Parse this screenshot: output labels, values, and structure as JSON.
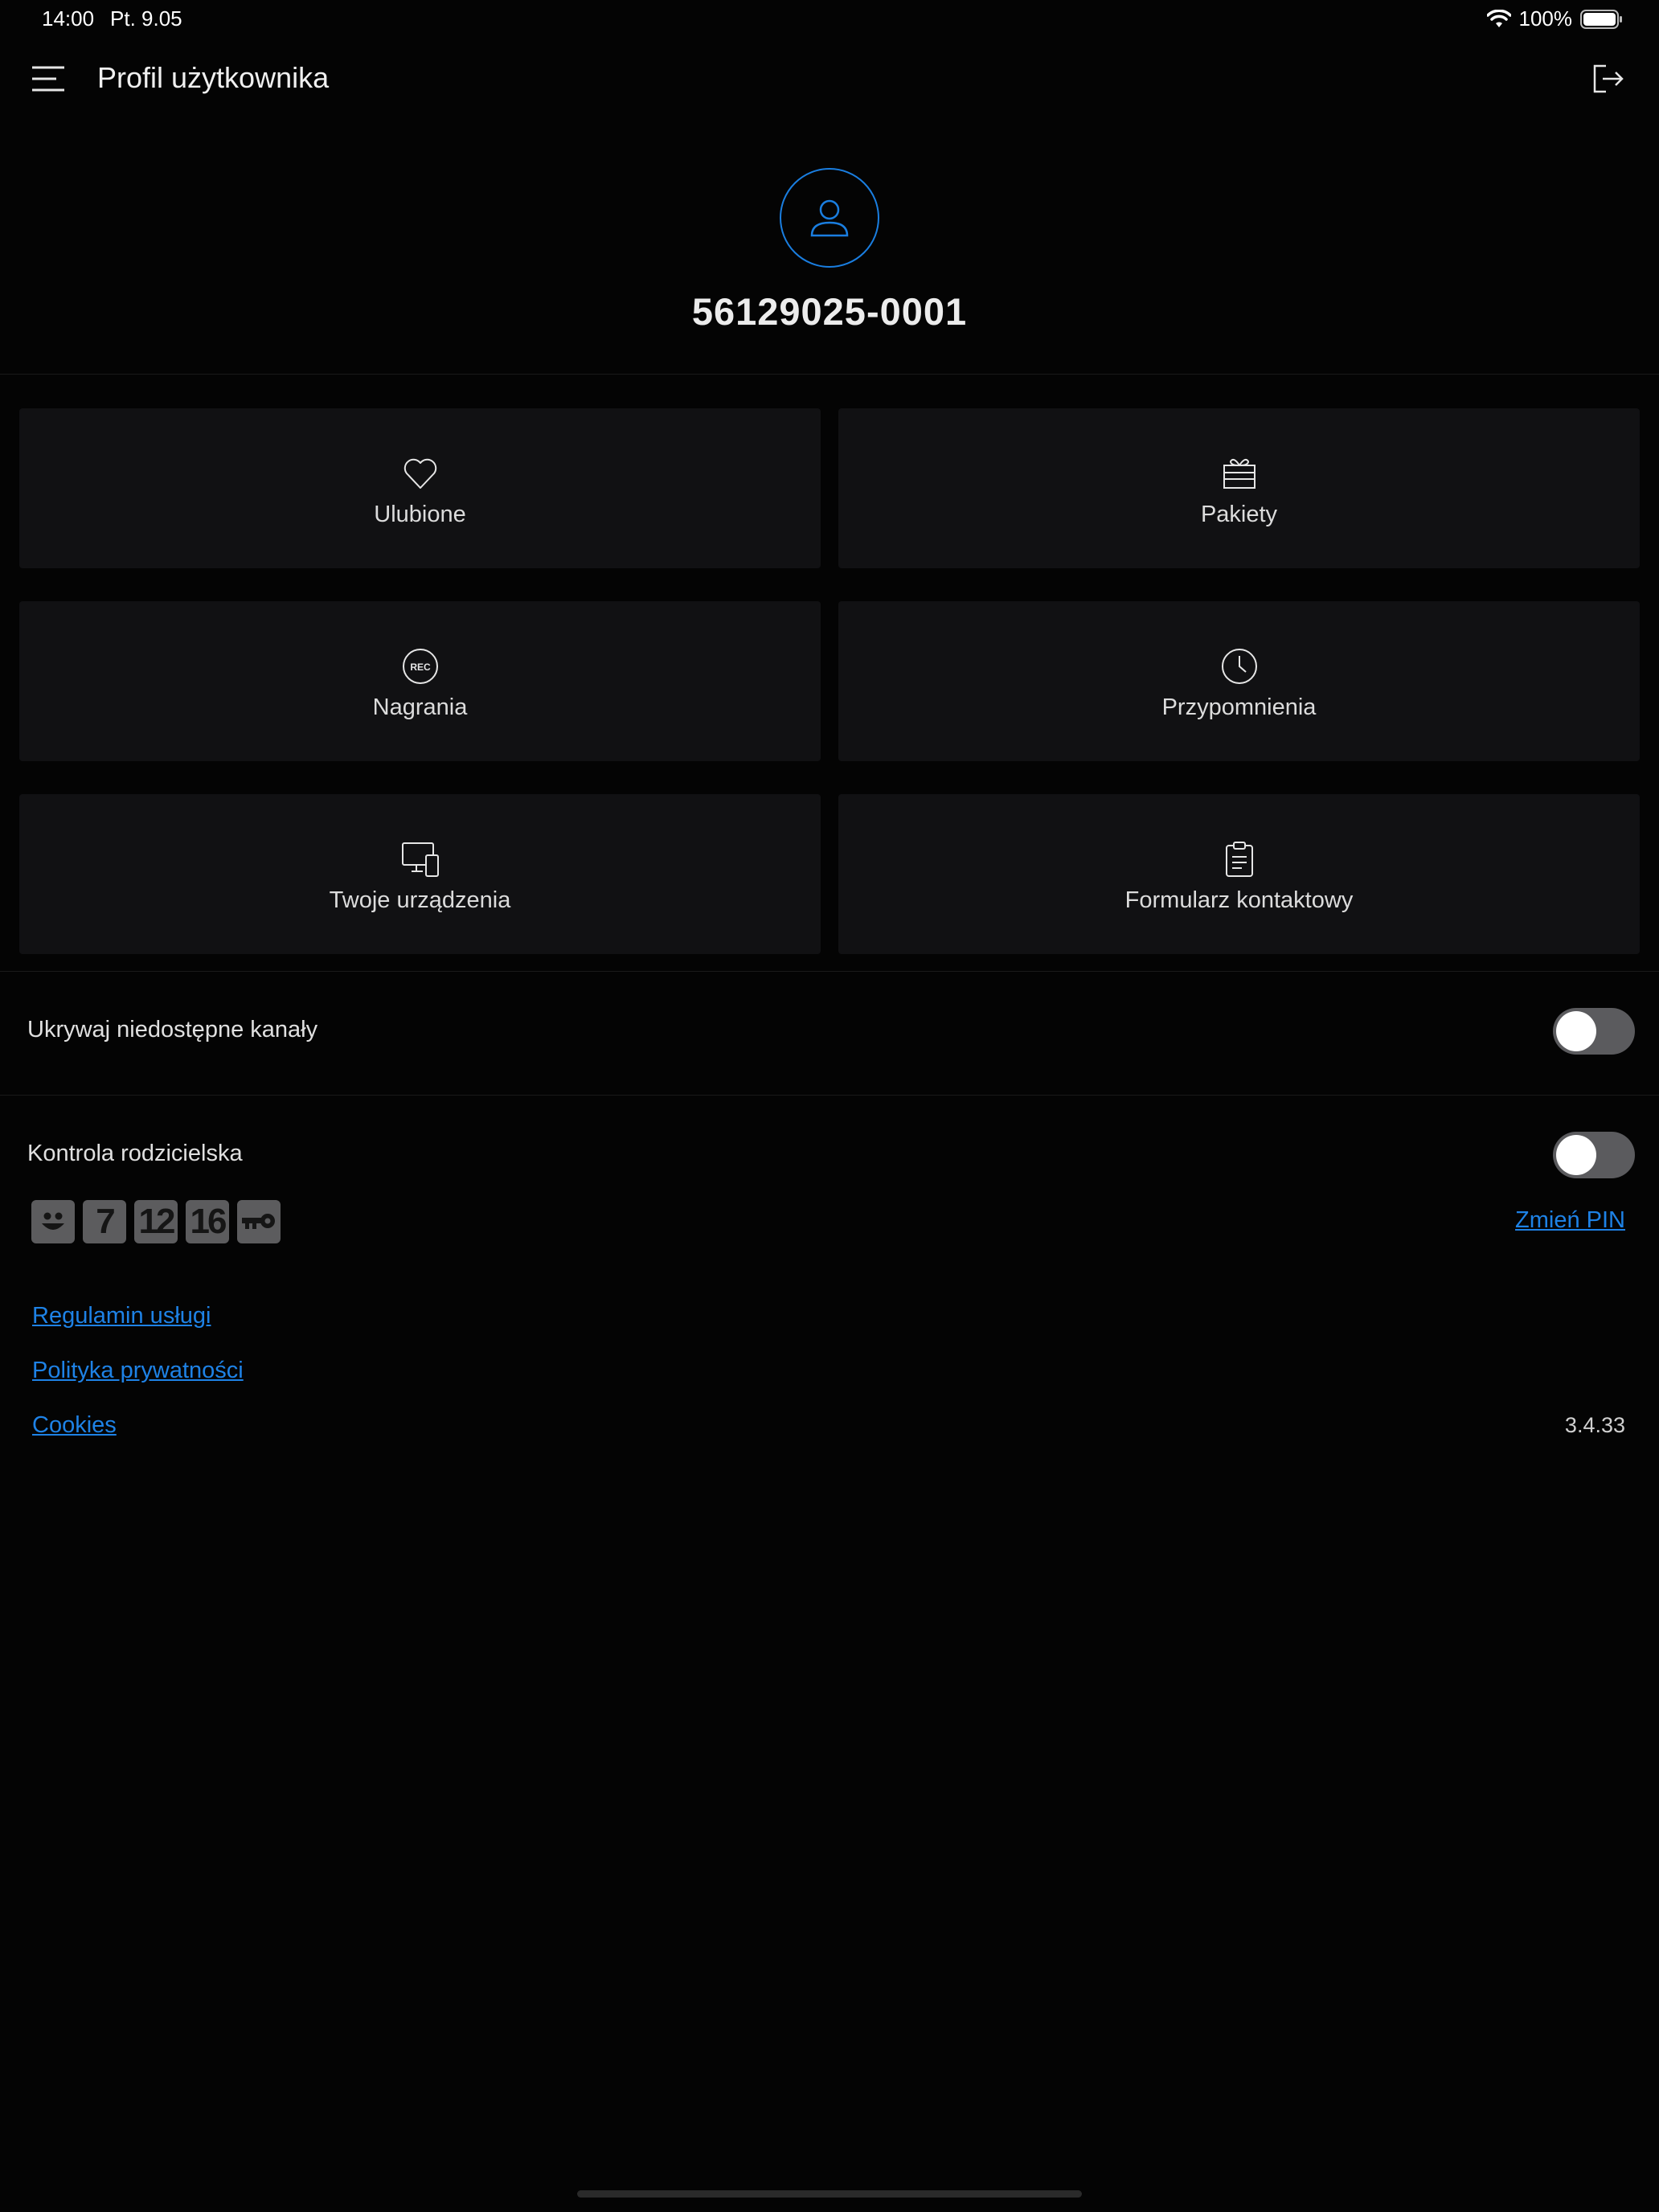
{
  "status_bar": {
    "time": "14:00",
    "date": "Pt. 9.05",
    "battery": "100%"
  },
  "header": {
    "title": "Profil użytkownika"
  },
  "profile": {
    "user_id": "56129025-0001"
  },
  "tiles": [
    {
      "label": "Ulubione",
      "icon": "heart-icon"
    },
    {
      "label": "Pakiety",
      "icon": "gift-box-icon"
    },
    {
      "label": "Nagrania",
      "icon": "rec-icon"
    },
    {
      "label": "Przypomnienia",
      "icon": "clock-icon"
    },
    {
      "label": "Twoje urządzenia",
      "icon": "devices-icon"
    },
    {
      "label": "Formularz kontaktowy",
      "icon": "clipboard-icon"
    }
  ],
  "settings": {
    "hide_channels": {
      "label": "Ukrywaj niedostępne kanały",
      "enabled": false
    },
    "parental_control": {
      "label": "Kontrola rodzicielska",
      "enabled": false,
      "change_pin": "Zmień PIN"
    }
  },
  "ratings": [
    "smiley",
    "7",
    "12",
    "16",
    "key"
  ],
  "links": {
    "terms": "Regulamin usługi",
    "privacy": "Polityka prywatności",
    "cookies": "Cookies"
  },
  "version": "3.4.33",
  "colors": {
    "accent": "#1a7ee0",
    "background": "#040404",
    "tile": "#111113"
  }
}
